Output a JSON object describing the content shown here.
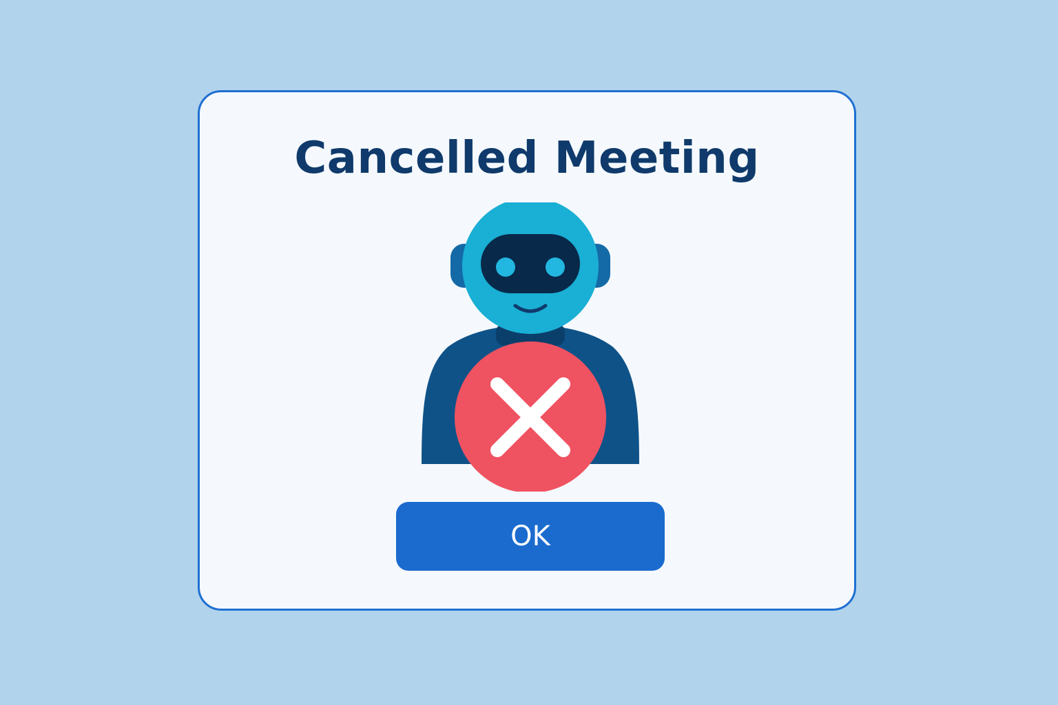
{
  "dialog": {
    "title": "Cancelled Meeting",
    "ok_label": "OK"
  },
  "icons": {
    "avatar": "robot-avatar-icon",
    "status": "cancel-x-icon"
  },
  "colors": {
    "background": "#b1d3ec",
    "dialog_border": "#1f6fd1",
    "title": "#0f3a6b",
    "button": "#1b6bcf",
    "robot_head": "#1aafd4",
    "robot_body": "#0f5288",
    "cancel_badge": "#ef5261"
  }
}
